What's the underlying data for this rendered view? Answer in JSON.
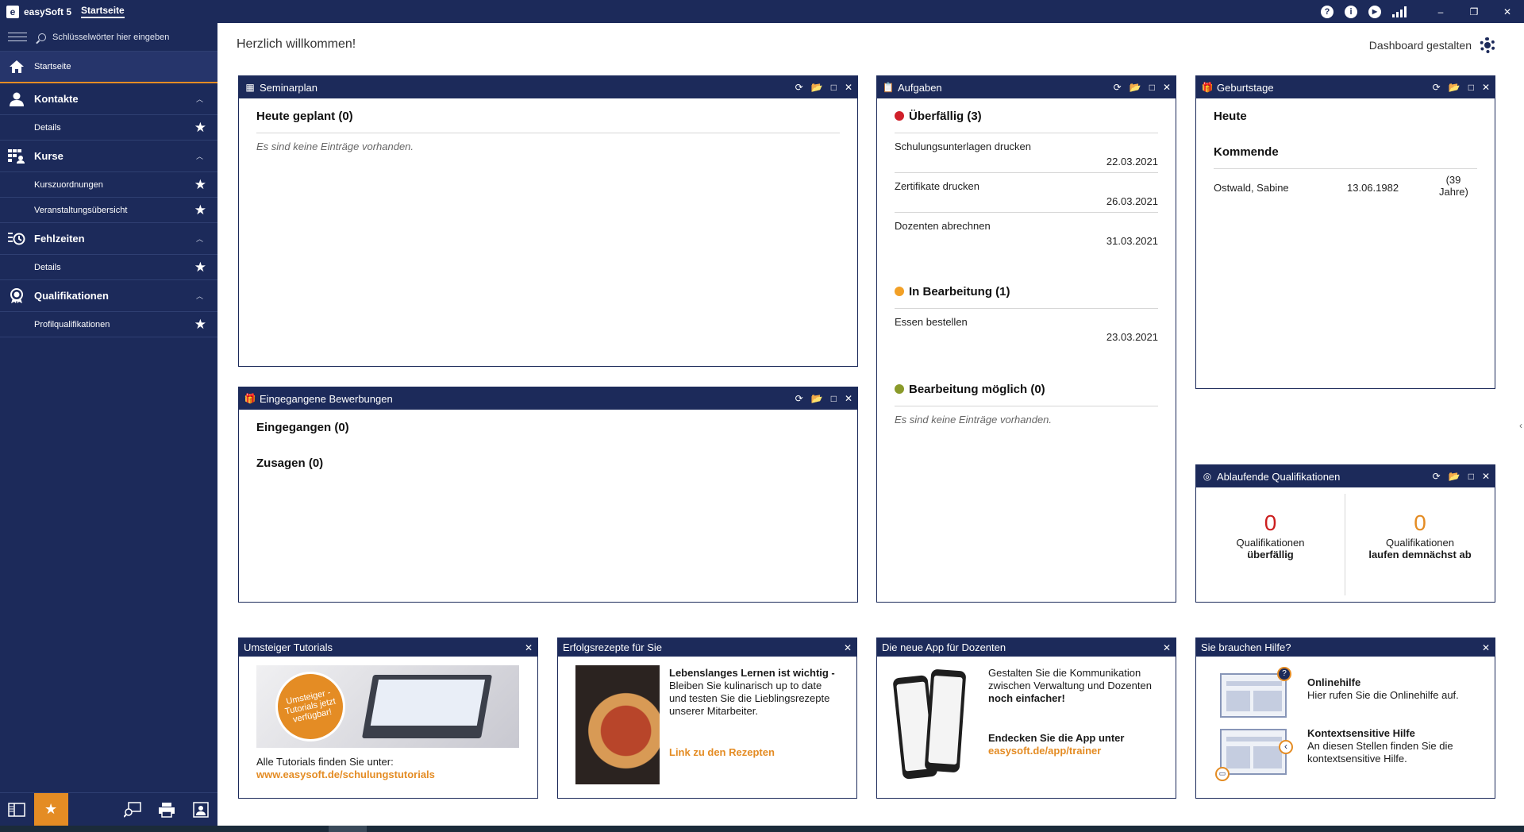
{
  "titlebar": {
    "app_name": "easySoft 5",
    "tab": "Startseite",
    "icons": [
      "help-icon",
      "info-icon",
      "play-icon",
      "signal-icon"
    ]
  },
  "sidebar": {
    "search_placeholder": "Schlüsselwörter hier eingeben",
    "home": "Startseite",
    "sections": [
      {
        "label": "Kontakte",
        "items": [
          "Details"
        ]
      },
      {
        "label": "Kurse",
        "items": [
          "Kurszuordnungen",
          "Veranstaltungsübersicht"
        ]
      },
      {
        "label": "Fehlzeiten",
        "items": [
          "Details"
        ]
      },
      {
        "label": "Qualifikationen",
        "items": [
          "Profilqualifikationen"
        ]
      }
    ]
  },
  "main": {
    "welcome": "Herzlich willkommen!",
    "dashboard_design": "Dashboard gestalten"
  },
  "widgets": {
    "seminarplan": {
      "title": "Seminarplan",
      "heading": "Heute geplant (0)",
      "empty": "Es sind keine Einträge vorhanden."
    },
    "bewerbungen": {
      "title": "Eingegangene Bewerbungen",
      "received": "Eingegangen (0)",
      "accepted": "Zusagen (0)"
    },
    "aufgaben": {
      "title": "Aufgaben",
      "overdue": {
        "heading": "Überfällig (3)",
        "color": "#d0202a",
        "tasks": [
          {
            "name": "Schulungsunterlagen drucken",
            "date": "22.03.2021"
          },
          {
            "name": "Zertifikate drucken",
            "date": "26.03.2021"
          },
          {
            "name": "Dozenten abrechnen",
            "date": "31.03.2021"
          }
        ]
      },
      "in_progress": {
        "heading": "In Bearbeitung (1)",
        "color": "#f2a026",
        "tasks": [
          {
            "name": "Essen bestellen",
            "date": "23.03.2021"
          }
        ]
      },
      "possible": {
        "heading": "Bearbeitung möglich (0)",
        "color": "#8a9a2a",
        "empty": "Es sind keine Einträge vorhanden."
      }
    },
    "geburtstage": {
      "title": "Geburtstage",
      "today": "Heute",
      "upcoming": "Kommende",
      "entries": [
        {
          "name": "Ostwald, Sabine",
          "date": "13.06.1982",
          "age_line1": "(39",
          "age_line2": "Jahre)"
        }
      ]
    },
    "qualifikationen": {
      "title": "Ablaufende Qualifikationen",
      "overdue_count": "0",
      "overdue_label1": "Qualifikationen",
      "overdue_label2": "überfällig",
      "soon_count": "0",
      "soon_label1": "Qualifikationen",
      "soon_label2": "laufen demnächst ab"
    },
    "tutorials": {
      "title": "Umsteiger Tutorials",
      "badge": "Umsteiger - Tutorials jetzt verfügbar!",
      "text": "Alle Tutorials finden Sie unter:",
      "link": "www.easysoft.de/schulungstutorials"
    },
    "rezepte": {
      "title": "Erfolgsrezepte für Sie",
      "bold_text": "Lebenslanges Lernen ist wichtig -",
      "text": " Bleiben Sie kulinarisch up to date und testen Sie die Lieblingsrezepte unserer Mitarbeiter.",
      "link": "Link zu den Rezepten"
    },
    "app": {
      "title": "Die neue App für Dozenten",
      "text1": "Gestalten Sie die Kommunikation zwischen Verwaltung und Dozenten ",
      "text1_bold": "noch einfacher!",
      "text2": "Endecken Sie die App unter",
      "link": "easysoft.de/app/trainer"
    },
    "hilfe": {
      "title": "Sie brauchen Hilfe?",
      "online_title": "Onlinehilfe",
      "online_text": "Hier rufen Sie die Onlinehilfe auf.",
      "context_title": "Kontextsensitive Hilfe",
      "context_text": "An diesen Stellen finden Sie die kontextsensitive Hilfe."
    }
  },
  "colors": {
    "primary": "#1c2a5a",
    "accent": "#e48c24",
    "red": "#cc1f1f"
  }
}
